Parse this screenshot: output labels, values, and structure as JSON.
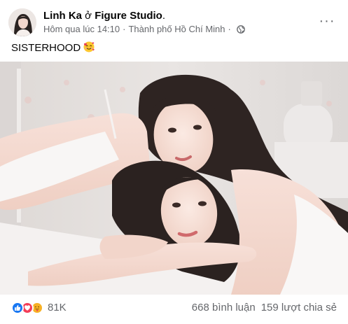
{
  "header": {
    "author": "Linh Ka",
    "separator": "ở",
    "place": "Figure Studio",
    "period": ".",
    "time": "Hôm qua lúc 14:10",
    "dot": "·",
    "location": "Thành phố Hồ Chí Minh",
    "privacy_icon": "globe-icon",
    "more_icon": "more-options-icon",
    "more_label": "···"
  },
  "post": {
    "caption": "SISTERHOOD",
    "caption_emoji": "smiling-face-with-hearts-emoji"
  },
  "footer": {
    "reaction_icons": [
      "like-reaction-icon",
      "love-reaction-icon",
      "care-reaction-icon"
    ],
    "reaction_count": "81K",
    "comments": "668 bình luận",
    "shares": "159 lượt chia sẻ"
  },
  "colors": {
    "text_primary": "#050505",
    "text_secondary": "#65676b",
    "like_blue": "#1877f2",
    "love_red": "#f33e58",
    "care_yellow": "#f7b125"
  }
}
